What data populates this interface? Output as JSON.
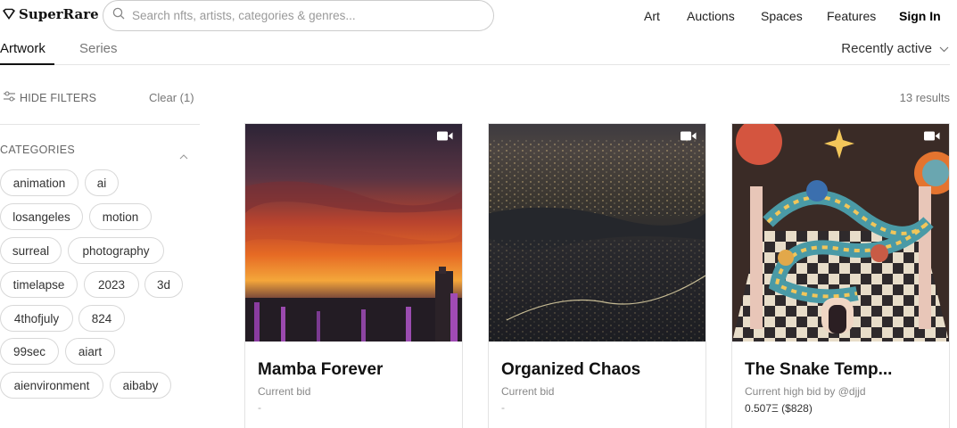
{
  "header": {
    "logo_text": "SuperRare",
    "search_placeholder": "Search nfts, artists, categories & genres...",
    "nav": [
      "Art",
      "Auctions",
      "Spaces",
      "Features"
    ],
    "sign_in": "Sign In"
  },
  "tabs": {
    "items": [
      "Artwork",
      "Series"
    ],
    "active": "Artwork"
  },
  "sort": {
    "selected": "Recently active"
  },
  "filters": {
    "hide_label": "HIDE FILTERS",
    "clear_label": "Clear (1)",
    "results": "13 results",
    "categories_title": "CATEGORIES",
    "chips": [
      "animation",
      "ai",
      "losangeles",
      "motion",
      "surreal",
      "photography",
      "timelapse",
      "2023",
      "3d",
      "4thofjuly",
      "824",
      "99sec",
      "aiart",
      "aienvironment",
      "aibaby"
    ]
  },
  "cards": [
    {
      "title": "Mamba Forever",
      "bid_label": "Current bid",
      "bid_value": "-"
    },
    {
      "title": "Organized Chaos",
      "bid_label": "Current bid",
      "bid_value": "-"
    },
    {
      "title": "The Snake Temp...",
      "bid_label": "Current high bid by @djjd",
      "bid_value": "0.507Ξ ($828)"
    }
  ],
  "colors": {
    "text": "#111111",
    "muted": "#777777",
    "border": "#d8d8d8"
  }
}
